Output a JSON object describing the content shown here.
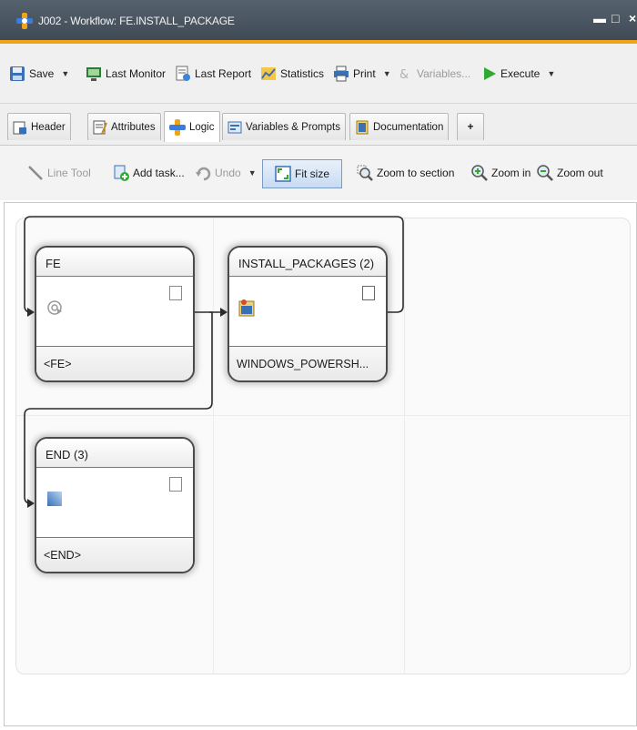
{
  "window": {
    "title": "J002 - Workflow: FE.INSTALL_PACKAGE",
    "minimize": "▬",
    "maximize": "□",
    "close": "×"
  },
  "toolbar": {
    "save": "Save",
    "last_monitor": "Last Monitor",
    "last_report": "Last Report",
    "statistics": "Statistics",
    "print": "Print",
    "variables": "Variables...",
    "execute": "Execute"
  },
  "tabs": [
    {
      "label": "Header"
    },
    {
      "label": "Attributes"
    },
    {
      "label": "Logic"
    },
    {
      "label": "Variables & Prompts"
    },
    {
      "label": "Documentation"
    },
    {
      "label": "+"
    }
  ],
  "logic_toolbar": {
    "line_tool": "Line Tool",
    "add_task": "Add task...",
    "undo": "Undo",
    "fit_size": "Fit size",
    "zoom_to_section": "Zoom to section",
    "zoom_in": "Zoom in",
    "zoom_out": "Zoom out"
  },
  "nodes": {
    "fe": {
      "title": "FE",
      "footer": "<FE>"
    },
    "install": {
      "title": "INSTALL_PACKAGES (2)",
      "footer": "WINDOWS_POWERSH..."
    },
    "end": {
      "title": "END (3)",
      "footer": "<END>"
    }
  },
  "colors": {
    "accent": "#f0a417",
    "titlebar": "#4a5560",
    "execute": "#2eaa2e"
  }
}
